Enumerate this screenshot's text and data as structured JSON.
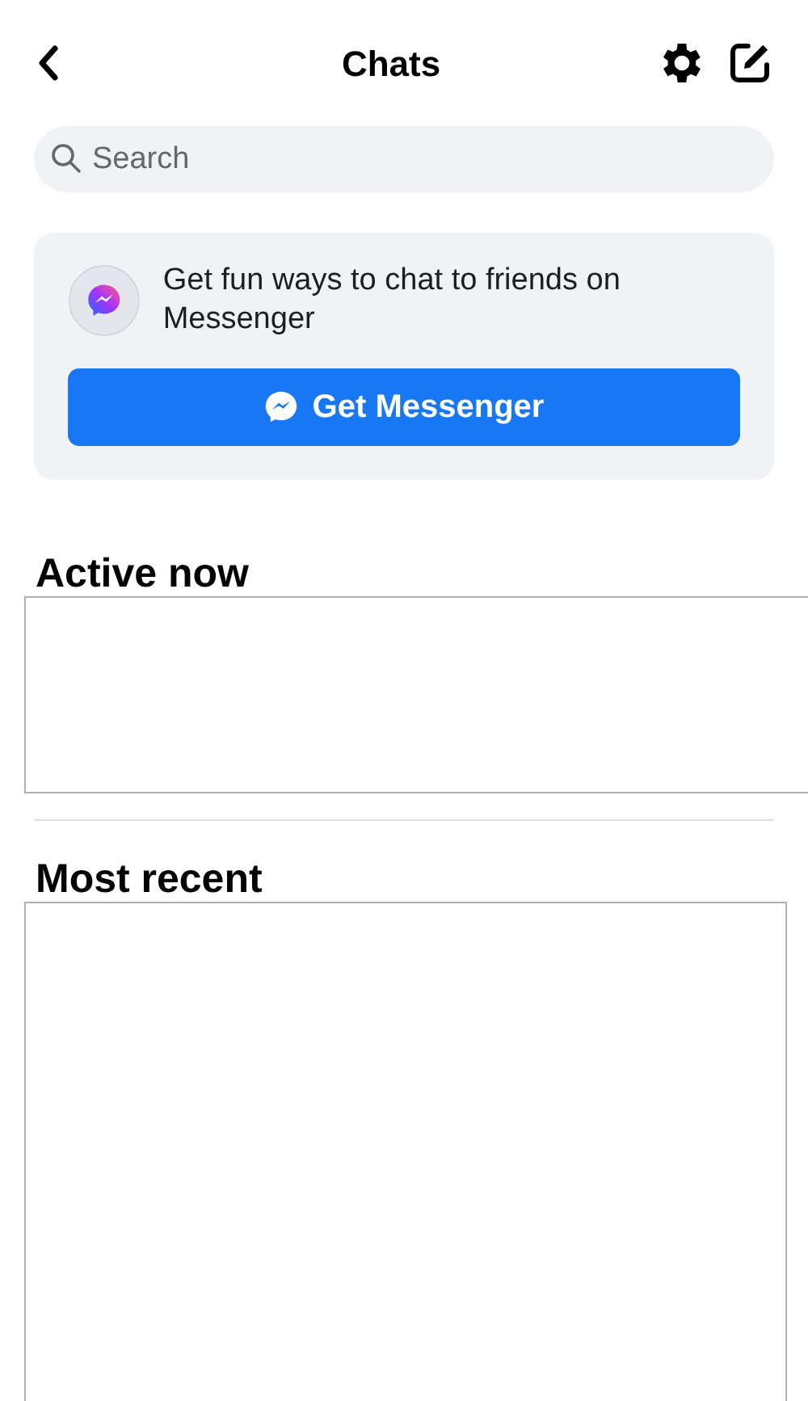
{
  "header": {
    "title": "Chats"
  },
  "search": {
    "placeholder": "Search"
  },
  "promo": {
    "text": "Get fun ways to chat to friends on Messenger",
    "button": "Get Messenger"
  },
  "sections": [
    {
      "title": "Active now",
      "kind": "active"
    },
    {
      "title": "Most recent",
      "kind": "recent"
    }
  ]
}
